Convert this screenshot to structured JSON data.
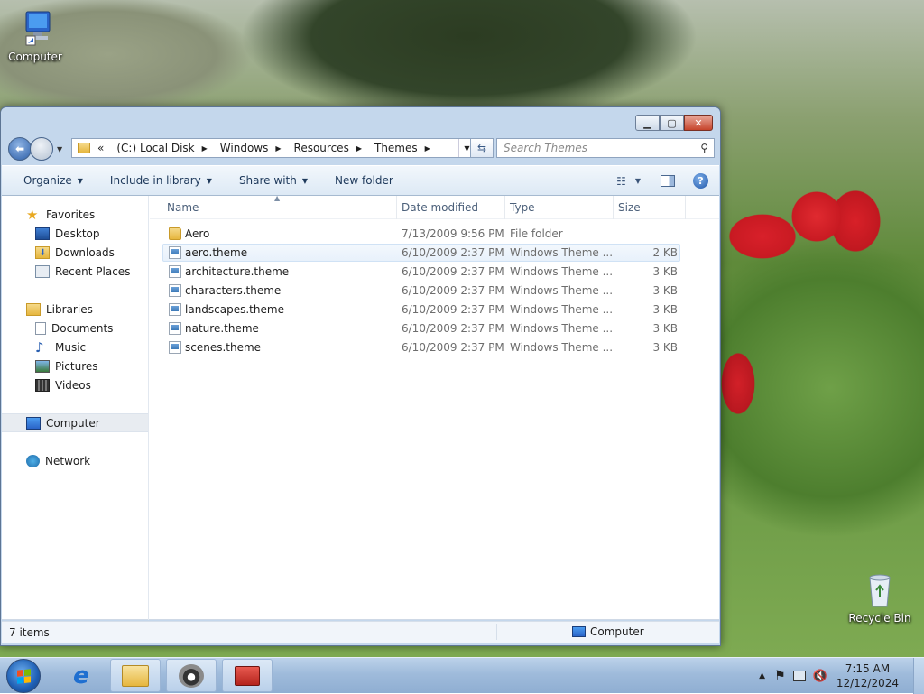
{
  "desktop": {
    "icons": [
      {
        "label": "Computer"
      },
      {
        "label": "Recycle Bin"
      }
    ]
  },
  "window": {
    "caption_buttons": {
      "minimize": "",
      "maximize": "",
      "close": ""
    },
    "address": {
      "overflow": "«",
      "segments": [
        "(C:) Local Disk",
        "Windows",
        "Resources",
        "Themes"
      ]
    },
    "search": {
      "placeholder": "Search Themes"
    },
    "command_bar": {
      "organize": "Organize",
      "include_in_library": "Include in library",
      "share_with": "Share with",
      "new_folder": "New folder"
    },
    "nav_pane": {
      "favorites": "Favorites",
      "favorites_items": [
        "Desktop",
        "Downloads",
        "Recent Places"
      ],
      "libraries": "Libraries",
      "libraries_items": [
        "Documents",
        "Music",
        "Pictures",
        "Videos"
      ],
      "computer": "Computer",
      "network": "Network"
    },
    "columns": {
      "name": "Name",
      "date_modified": "Date modified",
      "type": "Type",
      "size": "Size"
    },
    "files": [
      {
        "name": "Aero",
        "date": "7/13/2009 9:56 PM",
        "type": "File folder",
        "size": "",
        "kind": "folder"
      },
      {
        "name": "aero.theme",
        "date": "6/10/2009 2:37 PM",
        "type": "Windows Theme ...",
        "size": "2 KB",
        "kind": "theme"
      },
      {
        "name": "architecture.theme",
        "date": "6/10/2009 2:37 PM",
        "type": "Windows Theme ...",
        "size": "3 KB",
        "kind": "theme"
      },
      {
        "name": "characters.theme",
        "date": "6/10/2009 2:37 PM",
        "type": "Windows Theme ...",
        "size": "3 KB",
        "kind": "theme"
      },
      {
        "name": "landscapes.theme",
        "date": "6/10/2009 2:37 PM",
        "type": "Windows Theme ...",
        "size": "3 KB",
        "kind": "theme"
      },
      {
        "name": "nature.theme",
        "date": "6/10/2009 2:37 PM",
        "type": "Windows Theme ...",
        "size": "3 KB",
        "kind": "theme"
      },
      {
        "name": "scenes.theme",
        "date": "6/10/2009 2:37 PM",
        "type": "Windows Theme ...",
        "size": "3 KB",
        "kind": "theme"
      }
    ],
    "status": {
      "item_count": "7 items",
      "location": "Computer"
    }
  },
  "taskbar": {
    "clock": {
      "time": "7:15 AM",
      "date": "12/12/2024"
    }
  }
}
